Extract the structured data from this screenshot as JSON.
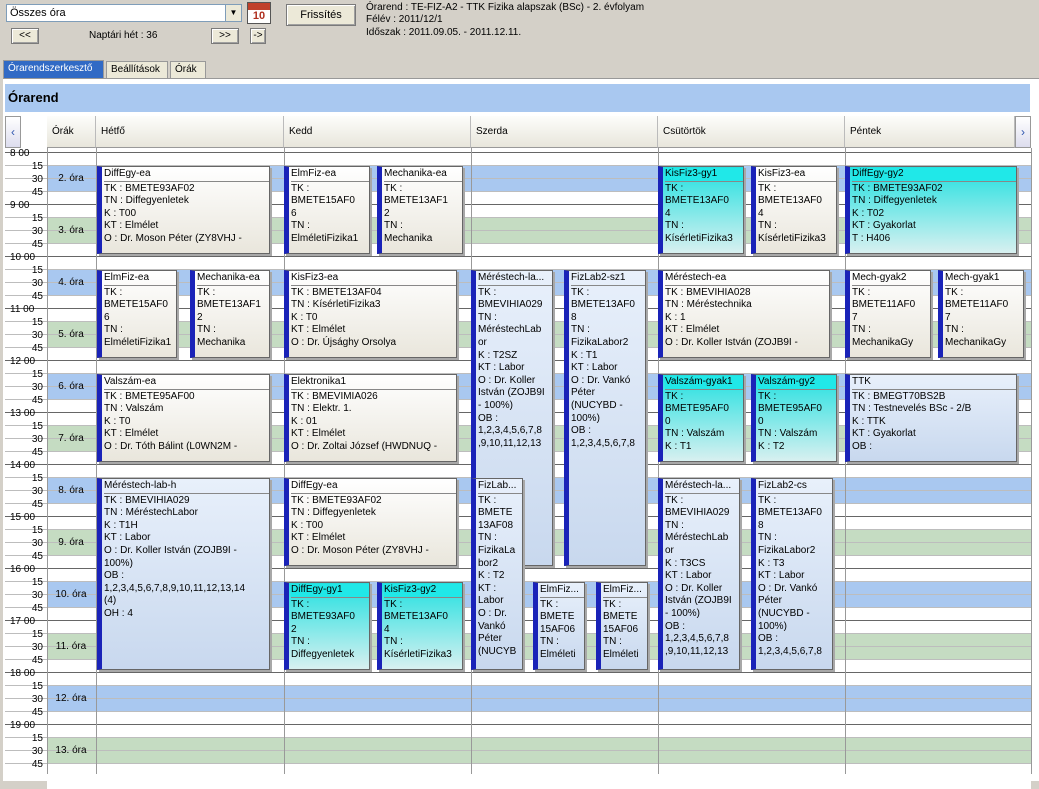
{
  "toolbar": {
    "combo_value": "Összes óra",
    "refresh_label": "Frissítés",
    "calendar_day": "10",
    "prev_label": "<<",
    "week_label": "Naptári hét : 36",
    "next_label": ">>",
    "next_small": "->"
  },
  "info": {
    "line1": "Órarend : TE-FIZ-A2 - TTK Fizika alapszak (BSc) - 2. évfolyam",
    "line2": "Félév : 2011/12/1",
    "line3": "Időszak : 2011.09.05. - 2011.12.11."
  },
  "tabs": [
    "Órarendszerkesztő",
    "Beállítások",
    "Órák"
  ],
  "title": "Órarend",
  "headers": {
    "hours": "Órák",
    "days": [
      "Hétfő",
      "Kedd",
      "Szerda",
      "Csütörtök",
      "Péntek"
    ]
  },
  "times": [
    "8 00",
    "15",
    "30",
    "45",
    "9 00",
    "15",
    "30",
    "45",
    "10 00",
    "15",
    "30",
    "45",
    "11 00",
    "15",
    "30",
    "45",
    "12 00",
    "15",
    "30",
    "45",
    "13 00",
    "15",
    "30",
    "45",
    "14 00",
    "15",
    "30",
    "45",
    "15 00",
    "15",
    "30",
    "45",
    "16 00",
    "15",
    "30",
    "45",
    "17 00",
    "15",
    "30",
    "45",
    "18 00",
    "15",
    "30",
    "45",
    "19 00",
    "15",
    "30",
    "45"
  ],
  "periods": [
    "2. óra",
    "3. óra",
    "4. óra",
    "5. óra",
    "6. óra",
    "7. óra",
    "8. óra",
    "9. óra",
    "10. óra",
    "11. óra",
    "12. óra",
    "13. óra"
  ],
  "events": [
    {
      "title": "DiffEgy-ea",
      "lines": "TK : BMETE93AF02\nTN : Diffegyenletek\nK : T00\nKT : Elmélet\nO : Dr. Moson Péter (ZY8VHJ -"
    },
    {
      "title": "ElmFiz-ea",
      "lines": "TK :\nBMETE15AF0\n6\nTN :\nElméletiFizika1"
    },
    {
      "title": "Mechanika-ea",
      "lines": "TK :\nBMETE13AF1\n2\nTN :\nMechanika"
    },
    {
      "title": "KisFiz3-gy1",
      "lines": "TK :\nBMETE13AF0\n4\nTN :\nKísérletiFizika3"
    },
    {
      "title": "KisFiz3-ea",
      "lines": "TK :\nBMETE13AF0\n4\nTN :\nKísérletiFizika3"
    },
    {
      "title": "DiffEgy-gy2",
      "lines": "TK : BMETE93AF02\nTN : Diffegyenletek\nK : T02\nKT : Gyakorlat\nT : H406"
    },
    {
      "title": "ElmFiz-ea",
      "lines": "TK :\nBMETE15AF0\n6\nTN :\nElméletiFizika1"
    },
    {
      "title": "Mechanika-ea",
      "lines": "TK :\nBMETE13AF1\n2\nTN :\nMechanika"
    },
    {
      "title": "KisFiz3-ea",
      "lines": "TK : BMETE13AF04\nTN : KísérletiFizika3\nK : T0\nKT : Elmélet\nO : Dr. Újsághy Orsolya"
    },
    {
      "title": "Méréstech-la...",
      "lines": "TK :\nBMEVIHIA029\nTN :\nMéréstechLab\nor\nK : T2SZ\nKT : Labor\nO : Dr. Koller\nIstván (ZOJB9I\n- 100%)\nOB :\n1,2,3,4,5,6,7,8\n,9,10,11,12,13"
    },
    {
      "title": "FizLab2-sz1",
      "lines": "TK :\nBMETE13AF0\n8\nTN :\nFizikaLabor2\nK : T1\nKT : Labor\nO : Dr. Vankó\nPéter\n(NUCYBD -\n100%)\nOB :\n1,2,3,4,5,6,7,8"
    },
    {
      "title": "Méréstech-ea",
      "lines": "TK : BMEVIHIA028\nTN : Méréstechnika\nK : 1\nKT : Elmélet\nO : Dr. Koller István (ZOJB9I -"
    },
    {
      "title": "Mech-gyak2",
      "lines": "TK :\nBMETE11AF0\n7\nTN :\nMechanikaGy"
    },
    {
      "title": "Mech-gyak1",
      "lines": "TK :\nBMETE11AF0\n7\nTN :\nMechanikaGy"
    },
    {
      "title": "Valszám-ea",
      "lines": "TK : BMETE95AF00\nTN : Valszám\nK : T0\nKT : Elmélet\nO : Dr. Tóth Bálint (L0WN2M -"
    },
    {
      "title": "Elektronika1",
      "lines": "TK : BMEVIMIA026\nTN : Elektr. 1.\nK : 01\nKT : Elmélet\nO : Dr. Zoltai József (HWDNUQ -"
    },
    {
      "title": "Valszám-gyak1",
      "lines": "TK :\nBMETE95AF0\n0\nTN : Valszám\nK : T1"
    },
    {
      "title": "Valszám-gy2",
      "lines": "TK :\nBMETE95AF0\n0\nTN : Valszám\nK : T2"
    },
    {
      "title": "TTK",
      "lines": "TK : BMEGT70BS2B\nTN : Testnevelés BSc - 2/B\nK : TTK\nKT : Gyakorlat\nOB :"
    },
    {
      "title": "Méréstech-lab-h",
      "lines": "TK : BMEVIHIA029\nTN : MéréstechLabor\nK : T1H\nKT : Labor\nO : Dr. Koller István (ZOJB9I -\n100%)\nOB :\n1,2,3,4,5,6,7,8,9,10,11,12,13,14\n(4)\nOH : 4"
    },
    {
      "title": "DiffEgy-ea",
      "lines": "TK : BMETE93AF02\nTN : Diffegyenletek\nK : T00\nKT : Elmélet\nO : Dr. Moson Péter (ZY8VHJ -"
    },
    {
      "title": "FizLab...",
      "lines": "TK :\nBMETE\n13AF08\nTN :\nFizikaLa\nbor2\nK : T2\nKT :\nLabor\nO : Dr.\nVankó\nPéter\n(NUCYB"
    },
    {
      "title": "Méréstech-la...",
      "lines": "TK :\nBMEVIHIA029\nTN :\nMéréstechLab\nor\nK : T3CS\nKT : Labor\nO : Dr. Koller\nIstván (ZOJB9I\n- 100%)\nOB :\n1,2,3,4,5,6,7,8\n,9,10,11,12,13"
    },
    {
      "title": "FizLab2-cs",
      "lines": "TK :\nBMETE13AF0\n8\nTN :\nFizikaLabor2\nK : T3\nKT : Labor\nO : Dr. Vankó\nPéter\n(NUCYBD -\n100%)\nOB :\n1,2,3,4,5,6,7,8"
    },
    {
      "title": "DiffEgy-gy1",
      "lines": "TK :\nBMETE93AF0\n2\nTN :\nDiffegyenletek"
    },
    {
      "title": "KisFiz3-gy2",
      "lines": "TK :\nBMETE13AF0\n4\nTN :\nKísérletiFizika3"
    },
    {
      "title": "ElmFiz...",
      "lines": "TK :\nBMETE\n15AF06\nTN :\nElméleti"
    },
    {
      "title": "ElmFiz...",
      "lines": "TK :\nBMETE\n15AF06\nTN :\nElméleti"
    }
  ]
}
